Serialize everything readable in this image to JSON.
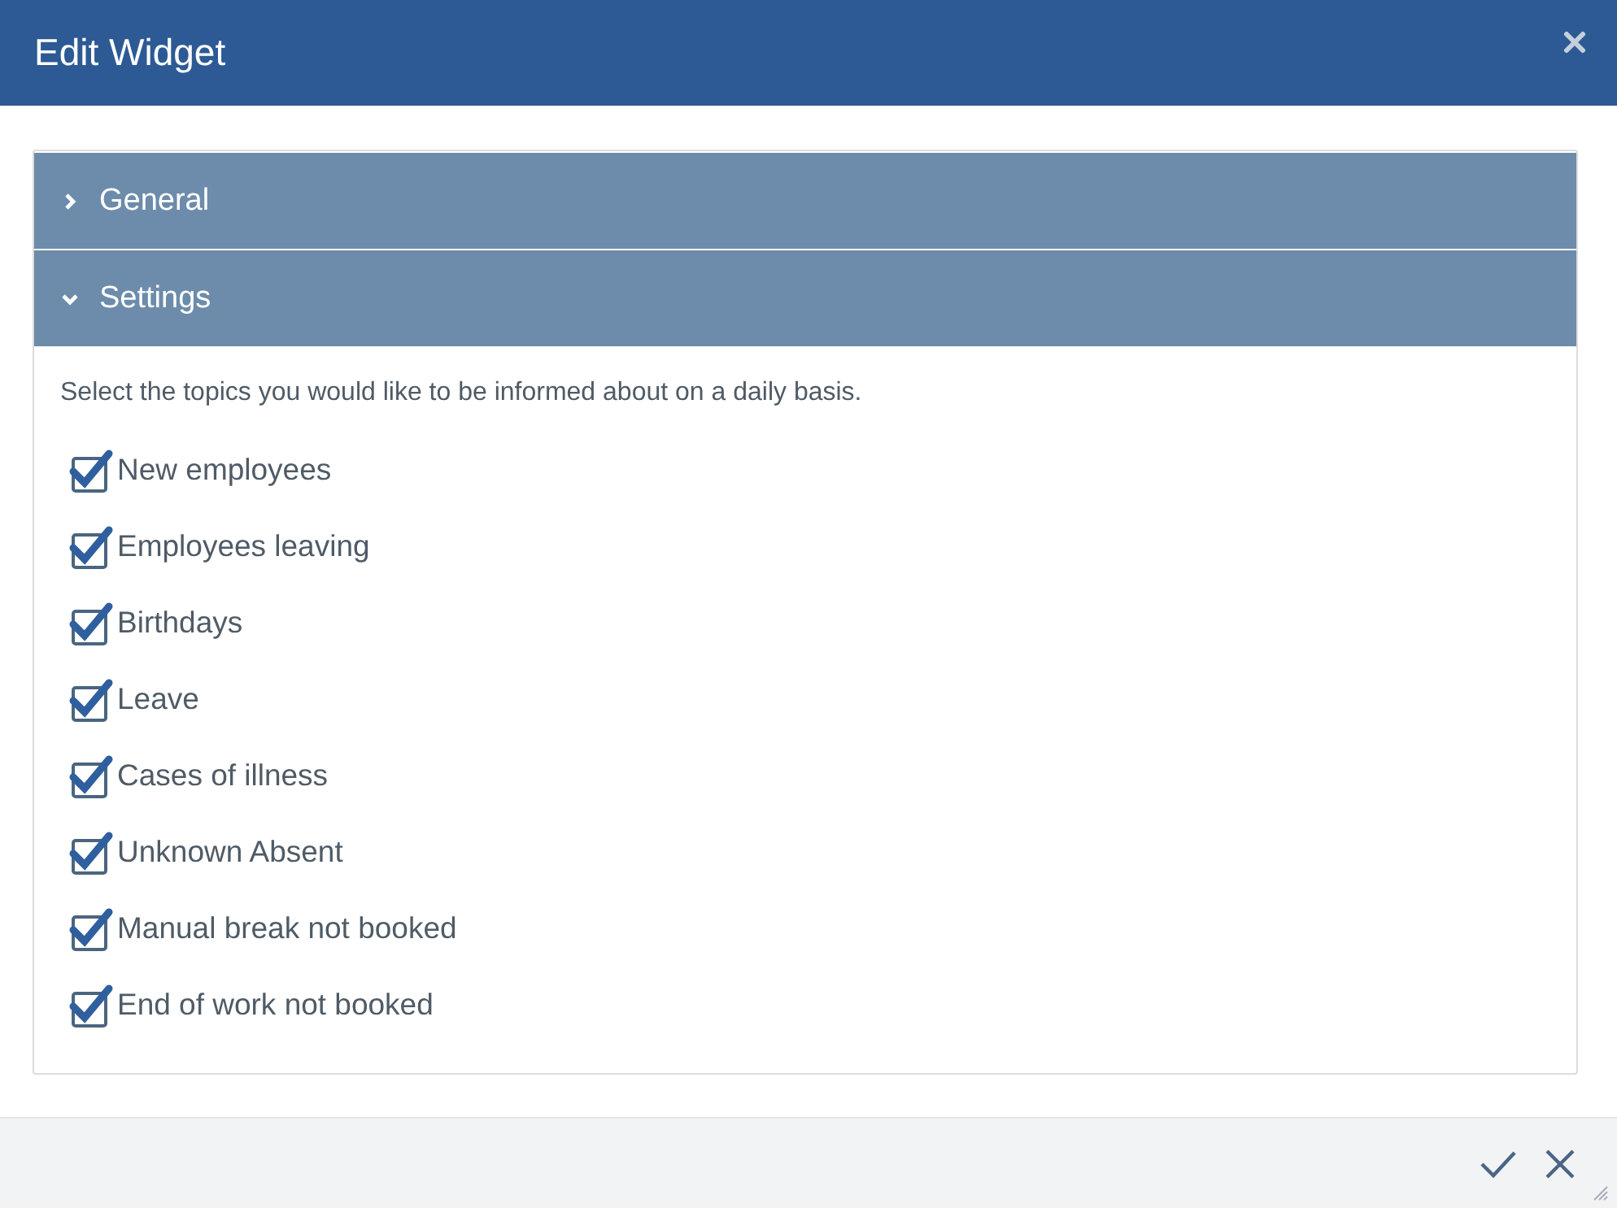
{
  "window": {
    "title": "Edit Widget"
  },
  "sections": [
    {
      "label": "General",
      "expanded": false
    },
    {
      "label": "Settings",
      "expanded": true,
      "description": "Select the topics you would like to be informed about on a daily basis.",
      "options": [
        {
          "label": "New employees",
          "checked": true
        },
        {
          "label": "Employees leaving",
          "checked": true
        },
        {
          "label": "Birthdays",
          "checked": true
        },
        {
          "label": "Leave",
          "checked": true
        },
        {
          "label": "Cases of illness",
          "checked": true
        },
        {
          "label": "Unknown Absent",
          "checked": true
        },
        {
          "label": "Manual break not booked",
          "checked": true
        },
        {
          "label": "End of work not booked",
          "checked": true
        }
      ]
    }
  ]
}
